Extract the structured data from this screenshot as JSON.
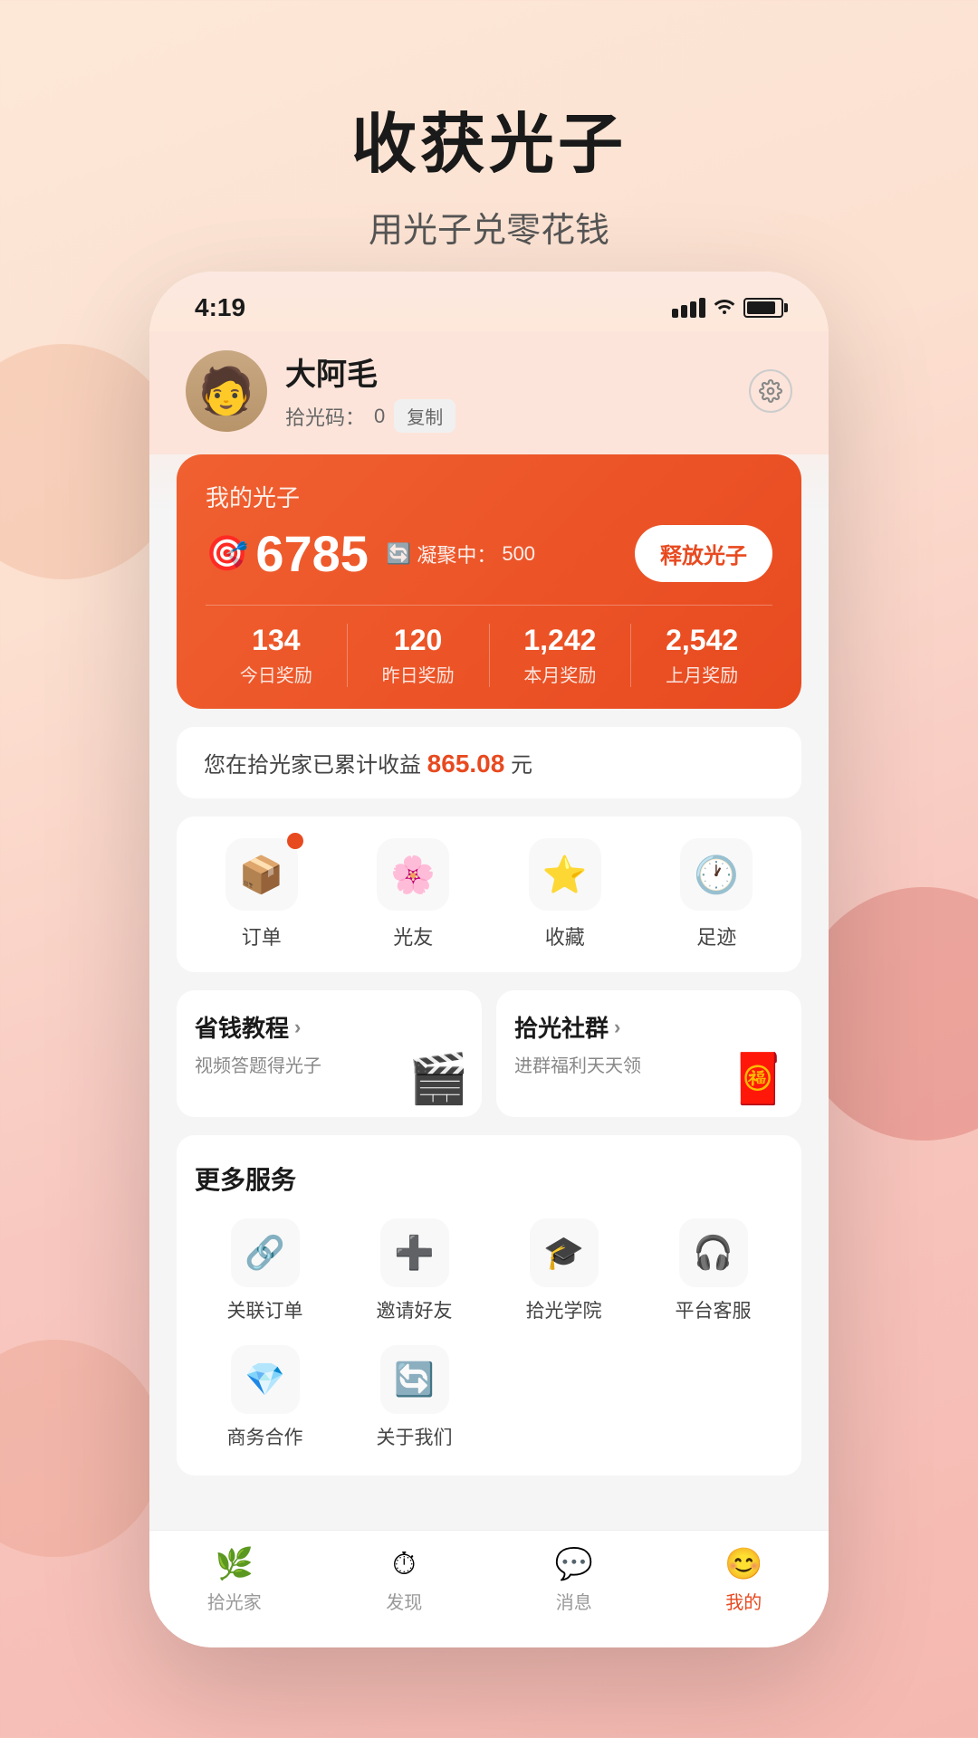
{
  "background": {
    "title": "收获光子",
    "subtitle": "用光子兑零花钱"
  },
  "phone": {
    "statusBar": {
      "time": "4:19"
    },
    "profile": {
      "name": "大阿毛",
      "code_label": "拾光码：",
      "code_value": "0",
      "copy_btn": "复制"
    },
    "guangziCard": {
      "title": "我的光子",
      "points": "6785",
      "freezing_label": "凝聚中：",
      "freezing_value": "500",
      "release_btn": "释放光子",
      "stats": [
        {
          "value": "134",
          "label": "今日奖励"
        },
        {
          "value": "120",
          "label": "昨日奖励"
        },
        {
          "value": "1,242",
          "label": "本月奖励"
        },
        {
          "value": "2,542",
          "label": "上月奖励"
        }
      ]
    },
    "earnings": {
      "prefix": "您在拾光家已累计收益",
      "amount": "865.08",
      "suffix": "元"
    },
    "quickIcons": [
      {
        "id": "orders",
        "label": "订单",
        "icon": "📦",
        "badge": true
      },
      {
        "id": "friends",
        "label": "光友",
        "icon": "🌸",
        "badge": false
      },
      {
        "id": "favorites",
        "label": "收藏",
        "icon": "⭐",
        "badge": false
      },
      {
        "id": "footprint",
        "label": "足迹",
        "icon": "🕐",
        "badge": false
      }
    ],
    "promoCards": [
      {
        "id": "tutorial",
        "title": "省钱教程",
        "subtitle": "视频答题得光子",
        "icon": "🎬"
      },
      {
        "id": "community",
        "title": "拾光社群",
        "subtitle": "进群福利天天领",
        "icon": "🧧"
      }
    ],
    "moreServices": {
      "title": "更多服务",
      "items": [
        {
          "id": "linked-orders",
          "label": "关联订单",
          "icon": "🔗"
        },
        {
          "id": "invite-friends",
          "label": "邀请好友",
          "icon": "➕"
        },
        {
          "id": "academy",
          "label": "拾光学院",
          "icon": "🎓"
        },
        {
          "id": "customer-service",
          "label": "平台客服",
          "icon": "🎧"
        },
        {
          "id": "business",
          "label": "商务合作",
          "icon": "💎"
        },
        {
          "id": "about-us",
          "label": "关于我们",
          "icon": "🔄"
        }
      ]
    },
    "bottomNav": [
      {
        "id": "home",
        "label": "拾光家",
        "icon": "🌿",
        "active": false
      },
      {
        "id": "discover",
        "label": "发现",
        "icon": "⏱",
        "active": false
      },
      {
        "id": "messages",
        "label": "消息",
        "icon": "💬",
        "active": false
      },
      {
        "id": "mine",
        "label": "我的",
        "icon": "😊",
        "active": true
      }
    ]
  }
}
